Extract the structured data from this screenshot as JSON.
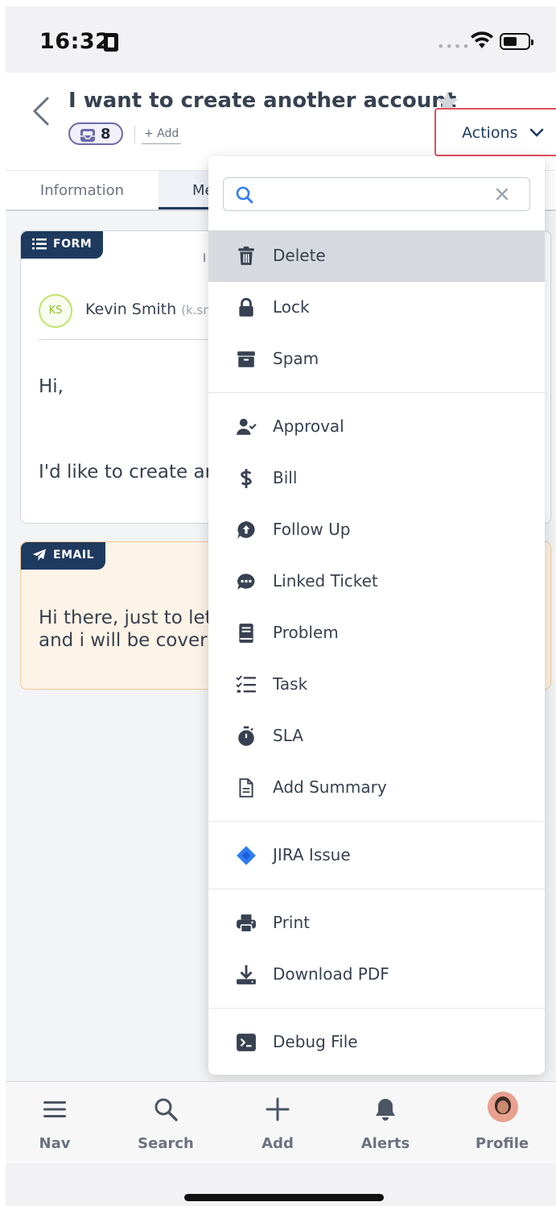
{
  "status_bar": {
    "time": "16:32"
  },
  "header": {
    "title": "I want to create another account",
    "message_count": "8",
    "add_tag_label": "+ Add",
    "actions_label": "Actions"
  },
  "tabs": [
    {
      "label": "Information"
    },
    {
      "label": "Me"
    }
  ],
  "form_card": {
    "tag": "FORM",
    "time_fragment": "I",
    "avatar_initials": "KS",
    "sender_name": "Kevin Smith",
    "sender_email": "(k.sm",
    "greeting": "Hi,",
    "body": "I'd like to create ar"
  },
  "email_card": {
    "tag": "EMAIL",
    "line1": "Hi there, just to let",
    "line2": "and i will be coveri"
  },
  "dropdown": {
    "search_placeholder": "",
    "items": [
      {
        "label": "Delete",
        "icon": "trash-icon",
        "active": true
      },
      {
        "label": "Lock",
        "icon": "lock-icon"
      },
      {
        "label": "Spam",
        "icon": "archive-icon"
      },
      {
        "label": "Approval",
        "icon": "user-check-icon"
      },
      {
        "label": "Bill",
        "icon": "dollar-icon"
      },
      {
        "label": "Follow Up",
        "icon": "follow-up-icon"
      },
      {
        "label": "Linked Ticket",
        "icon": "chat-dots-icon"
      },
      {
        "label": "Problem",
        "icon": "book-icon"
      },
      {
        "label": "Task",
        "icon": "checklist-icon"
      },
      {
        "label": "SLA",
        "icon": "stopwatch-icon"
      },
      {
        "label": "Add Summary",
        "icon": "document-icon"
      },
      {
        "label": "JIRA Issue",
        "icon": "jira-icon"
      },
      {
        "label": "Print",
        "icon": "printer-icon"
      },
      {
        "label": "Download PDF",
        "icon": "download-icon"
      },
      {
        "label": "Debug File",
        "icon": "terminal-icon"
      }
    ]
  },
  "bottom_nav": [
    {
      "label": "Nav",
      "icon": "menu-icon"
    },
    {
      "label": "Search",
      "icon": "search-icon"
    },
    {
      "label": "Add",
      "icon": "plus-icon"
    },
    {
      "label": "Alerts",
      "icon": "bell-icon"
    },
    {
      "label": "Profile",
      "icon": "avatar"
    }
  ],
  "colors": {
    "primary_navy": "#1f3a5f",
    "actions_border": "#e0505a",
    "email_card_bg": "#fdf3e6",
    "active_item_bg": "#d6dade",
    "jira_blue": "#2f7cf6"
  }
}
